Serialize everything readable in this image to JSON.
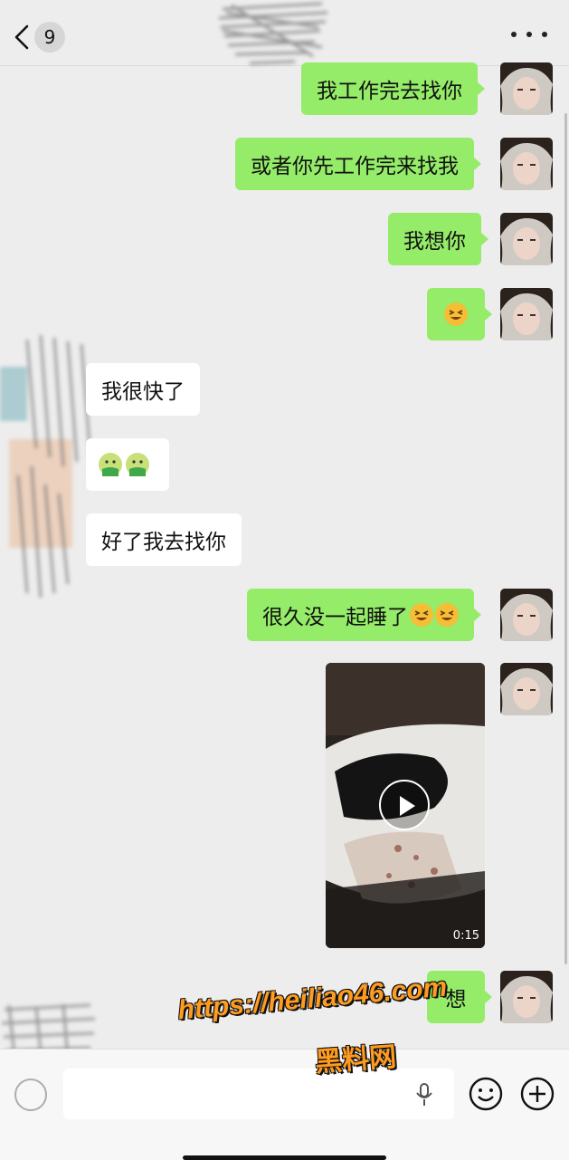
{
  "header": {
    "back_badge": "9"
  },
  "messages": {
    "m1": "我工作完去找你",
    "m2": "或者你先工作完来找我",
    "m3": "我想你",
    "m5": "我很快了",
    "m7": "好了我去找你",
    "m8": "很久没一起睡了",
    "m10": "想"
  },
  "video": {
    "duration": "0:15"
  },
  "watermark": {
    "url": "https://heiliao46.com",
    "site": "黑料网"
  },
  "colors": {
    "sent_bubble": "#95ec69",
    "received_bubble": "#ffffff",
    "background": "#ededed"
  },
  "icons": [
    "back-chevron-icon",
    "more-icon",
    "play-icon",
    "voice-icon",
    "microphone-icon",
    "emoji-icon",
    "plus-icon",
    "grinning-squint-emoji",
    "nauseated-emoji"
  ]
}
